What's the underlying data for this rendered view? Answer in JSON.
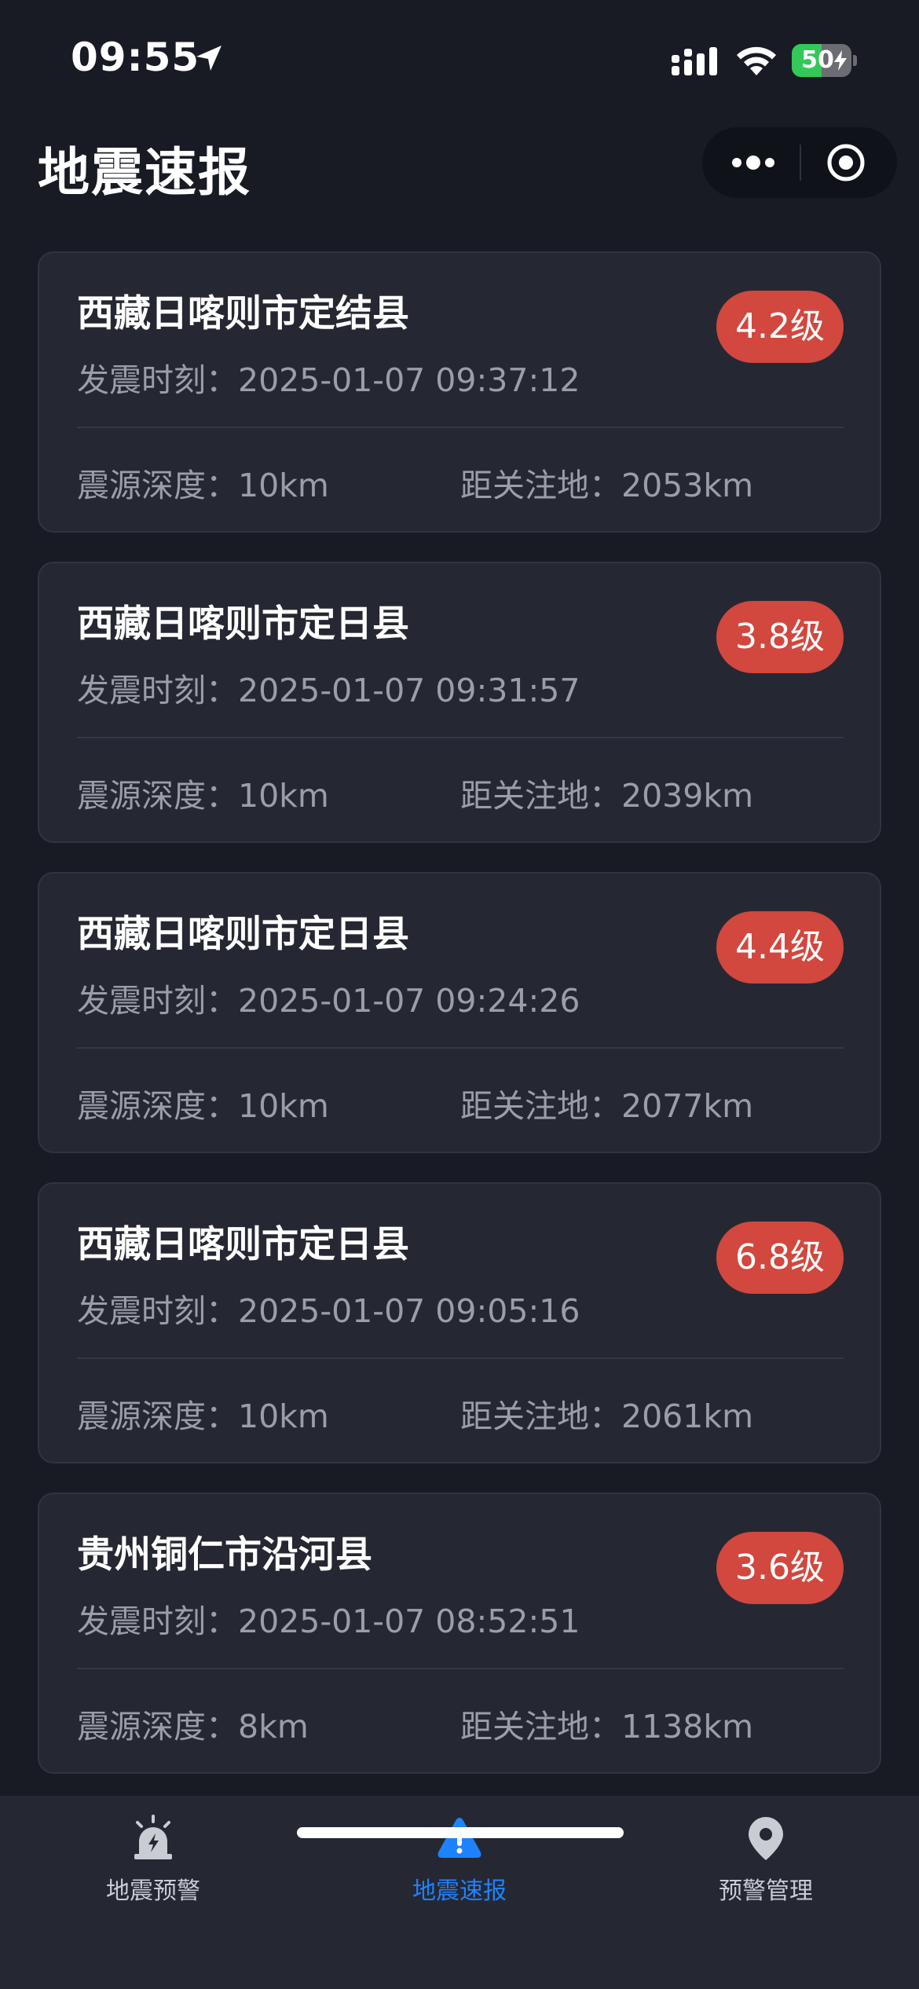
{
  "status_bar": {
    "time": "09:55",
    "battery": "50",
    "battery_level": 0.5
  },
  "header": {
    "title": "地震速报"
  },
  "quakes": [
    {
      "location": "西藏日喀则市定结县",
      "time": "发震时刻：2025-01-07 09:37:12",
      "magnitude": "4.2级",
      "depth": "震源深度：10km",
      "distance": "距关注地：2053km"
    },
    {
      "location": "西藏日喀则市定日县",
      "time": "发震时刻：2025-01-07 09:31:57",
      "magnitude": "3.8级",
      "depth": "震源深度：10km",
      "distance": "距关注地：2039km"
    },
    {
      "location": "西藏日喀则市定日县",
      "time": "发震时刻：2025-01-07 09:24:26",
      "magnitude": "4.4级",
      "depth": "震源深度：10km",
      "distance": "距关注地：2077km"
    },
    {
      "location": "西藏日喀则市定日县",
      "time": "发震时刻：2025-01-07 09:05:16",
      "magnitude": "6.8级",
      "depth": "震源深度：10km",
      "distance": "距关注地：2061km"
    },
    {
      "location": "贵州铜仁市沿河县",
      "time": "发震时刻：2025-01-07 08:52:51",
      "magnitude": "3.6级",
      "depth": "震源深度：8km",
      "distance": "距关注地：1138km"
    }
  ],
  "tabs": [
    {
      "label": "地震预警",
      "icon": "alarm-icon",
      "active": false
    },
    {
      "label": "地震速报",
      "icon": "alert-icon",
      "active": true
    },
    {
      "label": "预警管理",
      "icon": "location-pin-icon",
      "active": false
    }
  ],
  "colors": {
    "background": "#181b24",
    "card": "#252833",
    "magnitude_badge": "#d2473e",
    "active_tab": "#1e82ff",
    "secondary_text": "#9b9ea6",
    "battery_green": "#34c759"
  }
}
